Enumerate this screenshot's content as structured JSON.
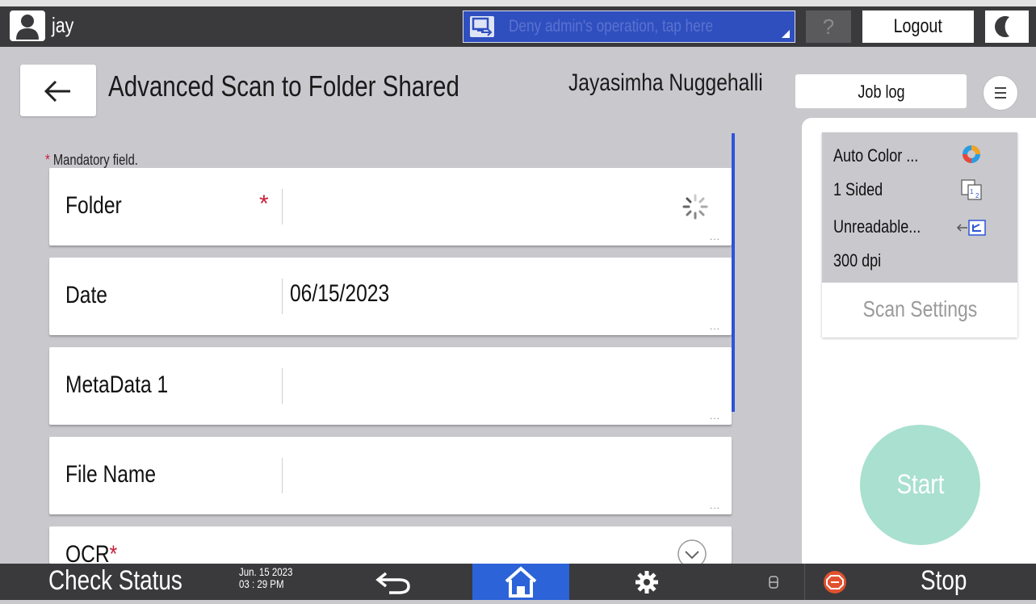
{
  "topbar": {
    "user": "jay",
    "notice": "Deny admin's operation, tap here",
    "help": "?",
    "logout": "Logout"
  },
  "header": {
    "title": "Advanced Scan to Folder Shared",
    "user_full_name": "Jayasimha Nuggehalli",
    "job_log": "Job log"
  },
  "form": {
    "mandatory_note": "Mandatory field.",
    "fields": [
      {
        "label": "Folder",
        "required": true,
        "value": "",
        "loading": true
      },
      {
        "label": "Date",
        "required": false,
        "value": "06/15/2023"
      },
      {
        "label": "MetaData 1",
        "required": false,
        "value": ""
      },
      {
        "label": "File Name",
        "required": false,
        "value": ""
      },
      {
        "label": "OCR",
        "required": true,
        "value": ""
      }
    ],
    "more_dots": "..."
  },
  "scan_settings": {
    "lines": [
      "Auto Color ...",
      "1 Sided",
      "Unreadable...",
      "300 dpi"
    ],
    "button": "Scan Settings"
  },
  "start": "Start",
  "bottombar": {
    "check_status": "Check Status",
    "date": "Jun. 15 2023",
    "time": "03 : 29 PM",
    "stop": "Stop"
  },
  "colors": {
    "accent_blue": "#2c63d9",
    "required_red": "#c8213c",
    "start_green": "#a9e0cf",
    "stop_orange": "#e2512f"
  },
  "icons": [
    "user-icon",
    "remote-panel-icon",
    "night-mode-icon",
    "back-arrow-icon",
    "hamburger-menu-icon",
    "loading-spinner-icon",
    "color-mode-icon",
    "duplex-icon",
    "original-orientation-icon",
    "undo-icon",
    "home-icon",
    "gear-icon",
    "memory-icon",
    "stop-icon",
    "chevron-down-icon"
  ]
}
